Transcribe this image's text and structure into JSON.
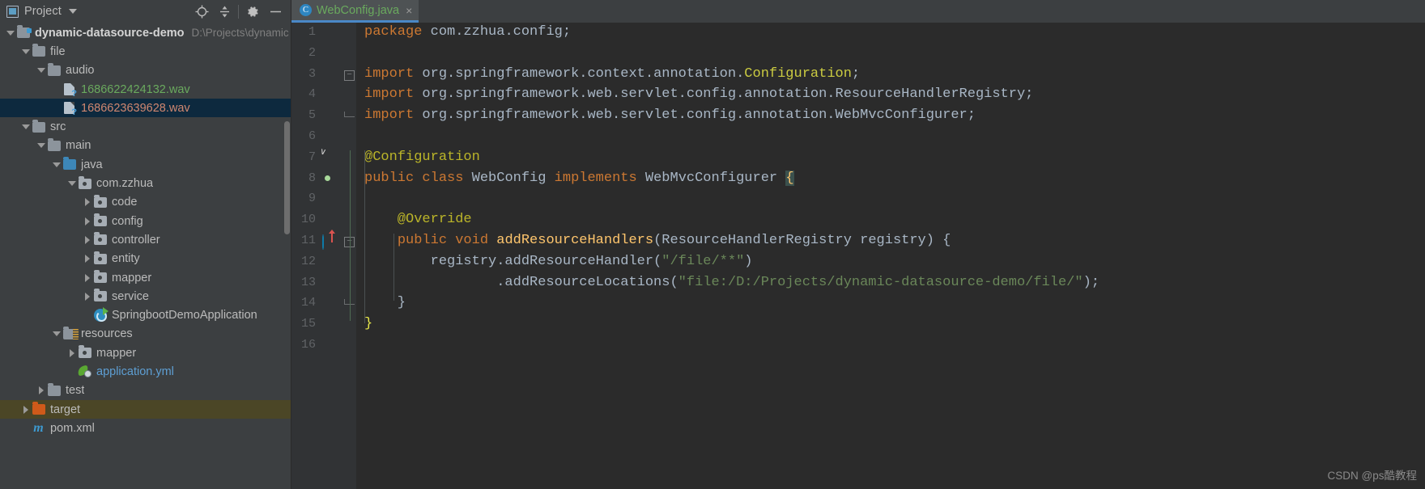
{
  "project_panel": {
    "toolbar": {
      "title": "Project",
      "title_icon": "project-view-icon",
      "dropdown_icon": "chevron-down-icon",
      "buttons": [
        {
          "name": "locate-icon",
          "glyph": "⊕"
        },
        {
          "name": "collapse-all-icon",
          "glyph": "≡"
        },
        {
          "name": "settings-gear-icon",
          "glyph": "⚙"
        },
        {
          "name": "hide-panel-icon",
          "glyph": "—"
        }
      ]
    },
    "tree": [
      {
        "label": "dynamic-datasource-demo",
        "sublabel": "D:\\Projects\\dynamic",
        "depth": 0,
        "twisty": "open",
        "icon": "module-folder-icon",
        "state": "bold"
      },
      {
        "label": "file",
        "sublabel": "",
        "depth": 1,
        "twisty": "open",
        "icon": "folder-icon",
        "state": ""
      },
      {
        "label": "audio",
        "sublabel": "",
        "depth": 2,
        "twisty": "open",
        "icon": "folder-icon",
        "state": ""
      },
      {
        "label": "1686622424132.wav",
        "sublabel": "",
        "depth": 3,
        "twisty": "none",
        "icon": "unknown-file-icon",
        "state": "green"
      },
      {
        "label": "1686623639628.wav",
        "sublabel": "",
        "depth": 3,
        "twisty": "none",
        "icon": "unknown-file-icon",
        "state": "selected"
      },
      {
        "label": "src",
        "sublabel": "",
        "depth": 1,
        "twisty": "open",
        "icon": "folder-icon",
        "state": ""
      },
      {
        "label": "main",
        "sublabel": "",
        "depth": 2,
        "twisty": "open",
        "icon": "folder-icon",
        "state": ""
      },
      {
        "label": "java",
        "sublabel": "",
        "depth": 3,
        "twisty": "open",
        "icon": "source-root-icon",
        "state": ""
      },
      {
        "label": "com.zzhua",
        "sublabel": "",
        "depth": 4,
        "twisty": "open",
        "icon": "package-icon",
        "state": ""
      },
      {
        "label": "code",
        "sublabel": "",
        "depth": 5,
        "twisty": "closed",
        "icon": "package-icon",
        "state": ""
      },
      {
        "label": "config",
        "sublabel": "",
        "depth": 5,
        "twisty": "closed",
        "icon": "package-icon",
        "state": ""
      },
      {
        "label": "controller",
        "sublabel": "",
        "depth": 5,
        "twisty": "closed",
        "icon": "package-icon",
        "state": ""
      },
      {
        "label": "entity",
        "sublabel": "",
        "depth": 5,
        "twisty": "closed",
        "icon": "package-icon",
        "state": ""
      },
      {
        "label": "mapper",
        "sublabel": "",
        "depth": 5,
        "twisty": "closed",
        "icon": "package-icon",
        "state": ""
      },
      {
        "label": "service",
        "sublabel": "",
        "depth": 5,
        "twisty": "closed",
        "icon": "package-icon",
        "state": ""
      },
      {
        "label": "SpringbootDemoApplication",
        "sublabel": "",
        "depth": 5,
        "twisty": "none",
        "icon": "spring-boot-icon",
        "state": ""
      },
      {
        "label": "resources",
        "sublabel": "",
        "depth": 3,
        "twisty": "open",
        "icon": "resources-root-icon",
        "state": ""
      },
      {
        "label": "mapper",
        "sublabel": "",
        "depth": 4,
        "twisty": "closed",
        "icon": "package-icon",
        "state": ""
      },
      {
        "label": "application.yml",
        "sublabel": "",
        "depth": 4,
        "twisty": "none",
        "icon": "spring-yaml-icon",
        "state": "blue"
      },
      {
        "label": "test",
        "sublabel": "",
        "depth": 2,
        "twisty": "closed",
        "icon": "folder-icon",
        "state": ""
      },
      {
        "label": "target",
        "sublabel": "",
        "depth": 1,
        "twisty": "closed",
        "icon": "excluded-folder-icon",
        "state": "highlight"
      },
      {
        "label": "pom.xml",
        "sublabel": "",
        "depth": 1,
        "twisty": "none",
        "icon": "maven-icon",
        "state": ""
      }
    ]
  },
  "editor": {
    "tab": {
      "label": "WebConfig.java",
      "badge": "C",
      "close_glyph": "×"
    },
    "line_numbers": [
      "1",
      "2",
      "3",
      "4",
      "5",
      "6",
      "7",
      "8",
      "9",
      "10",
      "11",
      "12",
      "13",
      "14",
      "15",
      "16"
    ],
    "gutter_icons": [
      {
        "line": 7,
        "name": "spring-bean-gutter-icon"
      },
      {
        "line": 8,
        "name": "spring-bean-class-gutter-icon"
      },
      {
        "line": 11,
        "name": "implementing-method-gutter-icon"
      }
    ],
    "code_lines": [
      {
        "n": 1,
        "tokens": [
          {
            "t": "package ",
            "c": "k"
          },
          {
            "t": "com.zzhua.config;",
            "c": "pl"
          }
        ]
      },
      {
        "n": 2,
        "tokens": []
      },
      {
        "n": 3,
        "tokens": [
          {
            "t": "import ",
            "c": "k"
          },
          {
            "t": "org.springframework.context.annotation.",
            "c": "pl"
          },
          {
            "t": "Configuration",
            "c": "cls"
          },
          {
            "t": ";",
            "c": "pl"
          }
        ]
      },
      {
        "n": 4,
        "tokens": [
          {
            "t": "import ",
            "c": "k"
          },
          {
            "t": "org.springframework.web.servlet.config.annotation.",
            "c": "pl"
          },
          {
            "t": "ResourceHandlerRegistry",
            "c": "pl"
          },
          {
            "t": ";",
            "c": "pl"
          }
        ]
      },
      {
        "n": 5,
        "tokens": [
          {
            "t": "import ",
            "c": "k"
          },
          {
            "t": "org.springframework.web.servlet.config.annotation.",
            "c": "pl"
          },
          {
            "t": "WebMvcConfigurer",
            "c": "pl"
          },
          {
            "t": ";",
            "c": "pl"
          }
        ]
      },
      {
        "n": 6,
        "tokens": []
      },
      {
        "n": 7,
        "tokens": [
          {
            "t": "@Configuration",
            "c": "ann"
          }
        ]
      },
      {
        "n": 8,
        "tokens": [
          {
            "t": "public ",
            "c": "k"
          },
          {
            "t": "class ",
            "c": "k"
          },
          {
            "t": "WebConfig ",
            "c": "pl"
          },
          {
            "t": "implements ",
            "c": "k"
          },
          {
            "t": "WebMvcConfigurer ",
            "c": "pl"
          },
          {
            "t": "{",
            "c": "brace-hl"
          }
        ]
      },
      {
        "n": 9,
        "tokens": []
      },
      {
        "n": 10,
        "tokens": [
          {
            "t": "    @Override",
            "c": "ann"
          }
        ]
      },
      {
        "n": 11,
        "tokens": [
          {
            "t": "    ",
            "c": "pl"
          },
          {
            "t": "public ",
            "c": "k"
          },
          {
            "t": "void ",
            "c": "k"
          },
          {
            "t": "addResourceHandlers",
            "c": "mth"
          },
          {
            "t": "(ResourceHandlerRegistry registry) {",
            "c": "pl"
          }
        ]
      },
      {
        "n": 12,
        "tokens": [
          {
            "t": "        registry.addResourceHandler(",
            "c": "pl"
          },
          {
            "t": "\"/file/**\"",
            "c": "str"
          },
          {
            "t": ")",
            "c": "pl"
          }
        ]
      },
      {
        "n": 13,
        "tokens": [
          {
            "t": "                .addResourceLocations(",
            "c": "pl"
          },
          {
            "t": "\"file:/D:/Projects/dynamic-datasource-demo/file/\"",
            "c": "str"
          },
          {
            "t": ");",
            "c": "pl"
          }
        ]
      },
      {
        "n": 14,
        "tokens": [
          {
            "t": "    }",
            "c": "pl"
          }
        ]
      },
      {
        "n": 15,
        "tokens": [
          {
            "t": "}",
            "c": "brace-y"
          }
        ]
      },
      {
        "n": 16,
        "tokens": []
      }
    ]
  },
  "watermark": "CSDN @ps酷教程",
  "colors": {
    "panel_bg": "#3c3f41",
    "editor_bg": "#2b2b2b",
    "gutter_bg": "#313335",
    "selection": "#0d293e",
    "highlight_row": "#4b4626",
    "tab_underline": "#4a88c7",
    "keyword": "#cc7832",
    "string": "#6a8759",
    "method": "#ffc66d",
    "annotation": "#bbb529",
    "plain": "#a9b7c6"
  }
}
